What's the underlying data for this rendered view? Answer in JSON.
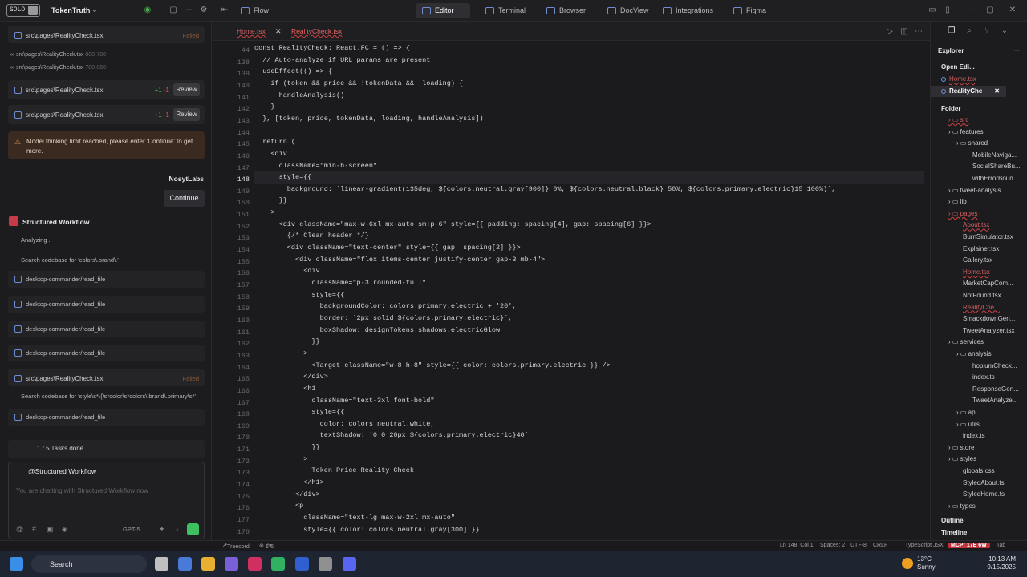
{
  "app": {
    "logo": "SOLO",
    "project": "TokenTruth"
  },
  "top_tabs": [
    {
      "label": "Flow"
    },
    {
      "label": "Editor"
    },
    {
      "label": "Terminal"
    },
    {
      "label": "Browser"
    },
    {
      "label": "DocView"
    },
    {
      "label": "Integrations"
    },
    {
      "label": "Figma"
    }
  ],
  "left": {
    "file1": {
      "name": "src\\pages\\RealityCheck.tsx",
      "status": "Failed"
    },
    "small1": {
      "name": "src\\pages\\RealityCheck.tsx",
      "range": "800-780"
    },
    "small2": {
      "name": "src\\pages\\RealityCheck.tsx",
      "range": "780-860"
    },
    "review1": {
      "name": "src\\pages\\RealityCheck.tsx",
      "plus": "+1",
      "minus": "-1",
      "button": "Review"
    },
    "review2": {
      "name": "src\\pages\\RealityCheck.tsx",
      "plus": "+1",
      "minus": "-1",
      "button": "Review"
    },
    "warning": "Model thinking limit reached, please enter 'Continue' to get more.",
    "user": "NosytLabs",
    "continue": "Continue",
    "workflow_title": "Structured Workflow",
    "analyzing": "Analyzing ..",
    "search1": "Search codebase for 'colors\\.brand\\.'",
    "tools": [
      "desktop-commander/read_file",
      "desktop-commander/read_file",
      "desktop-commander/read_file",
      "desktop-commander/read_file"
    ],
    "file2": {
      "name": "src\\pages\\RealityCheck.tsx",
      "status": "Failed"
    },
    "search2": "Search codebase for 'style\\s*\\{\\s*color\\s*colors\\.brand\\.primary\\s*'",
    "tool5": "desktop-commander/read_file",
    "tasks": "1 / 5 Tasks done",
    "chat_header": "@Structured Workflow",
    "chat_placeholder": "You are chatting with Structured Workflow now",
    "model": "GPT-5"
  },
  "editor": {
    "tabs": [
      "Home.tsx",
      "RealityCheck.tsx"
    ],
    "line_numbers": [
      "44",
      "138",
      "139",
      "140",
      "141",
      "142",
      "143",
      "144",
      "145",
      "146",
      "147",
      "148",
      "149",
      "150",
      "151",
      "152",
      "153",
      "154",
      "155",
      "156",
      "157",
      "158",
      "159",
      "160",
      "161",
      "162",
      "163",
      "164",
      "165",
      "166",
      "167",
      "168",
      "169",
      "170",
      "171",
      "172",
      "173",
      "174",
      "175",
      "176",
      "177",
      "178"
    ],
    "lines": [
      "const RealityCheck: React.FC = () => {",
      "  // Auto-analyze if URL params are present",
      "  useEffect(() => {",
      "    if (token && price && !tokenData && !loading) {",
      "      handleAnalysis()",
      "    }",
      "  }, [token, price, tokenData, loading, handleAnalysis])",
      "",
      "  return (",
      "    <div",
      "      className=\"min-h-screen\"",
      "      style={{",
      "        background: `linear-gradient(135deg, ${colors.neutral.gray[900]} 0%, ${colors.neutral.black} 50%, ${colors.primary.electric}15 100%)`,",
      "      }}",
      "    >",
      "      <div className=\"max-w-6xl mx-auto sm:p-6\" style={{ padding: spacing[4], gap: spacing[6] }}>",
      "        {/* Clean header */}",
      "        <div className=\"text-center\" style={{ gap: spacing[2] }}>",
      "          <div className=\"flex items-center justify-center gap-3 mb-4\">",
      "            <div",
      "              className=\"p-3 rounded-full\"",
      "              style={{",
      "                backgroundColor: colors.primary.electric + '20',",
      "                border: `2px solid ${colors.primary.electric}`,",
      "                boxShadow: designTokens.shadows.electricGlow",
      "              }}",
      "            >",
      "              <Target className=\"w-8 h-8\" style={{ color: colors.primary.electric }} />",
      "            </div>",
      "            <h1",
      "              className=\"text-3xl font-bold\"",
      "              style={{",
      "                color: colors.neutral.white,",
      "                textShadow: `0 0 20px ${colors.primary.electric}40`",
      "              }}",
      "            >",
      "              Token Price Reality Check",
      "            </h1>",
      "          </div>",
      "          <p",
      "            className=\"text-lg max-w-2xl mx-auto\"",
      "            style={{ color: colors.neutral.gray[300] }}"
    ]
  },
  "explorer": {
    "title": "Explorer",
    "open_editors": "Open Edi...",
    "open_files": [
      {
        "name": "Home.tsx",
        "path": "src...",
        "badge": "4"
      },
      {
        "name": "RealityChe",
        "badge": "9+"
      }
    ],
    "folder": "Folder",
    "tree": [
      {
        "name": "src"
      },
      {
        "name": "features"
      },
      {
        "name": "shared"
      },
      {
        "name": "MobileNaviga..."
      },
      {
        "name": "SocialShareBu..."
      },
      {
        "name": "withErrorBoun..."
      },
      {
        "name": "tweet-analysis"
      },
      {
        "name": "lib"
      },
      {
        "name": "pages"
      },
      {
        "name": "About.tsx"
      },
      {
        "name": "BurnSimulator.tsx"
      },
      {
        "name": "Explainer.tsx"
      },
      {
        "name": "Gallery.tsx"
      },
      {
        "name": "Home.tsx"
      },
      {
        "name": "MarketCapCom..."
      },
      {
        "name": "NotFound.tsx"
      },
      {
        "name": "RealityChe..."
      },
      {
        "name": "SmackdownGen..."
      },
      {
        "name": "TweetAnalyzer.tsx"
      },
      {
        "name": "services"
      },
      {
        "name": "analysis"
      },
      {
        "name": "hopiumCheck..."
      },
      {
        "name": "index.ts"
      },
      {
        "name": "ResponseGen..."
      },
      {
        "name": "TweetAnalyze..."
      },
      {
        "name": "api"
      },
      {
        "name": "utils"
      },
      {
        "name": "index.ts"
      },
      {
        "name": "store"
      },
      {
        "name": "styles"
      },
      {
        "name": "globals.css"
      },
      {
        "name": "StyledAbout.ts"
      },
      {
        "name": "StyledHome.ts"
      },
      {
        "name": "types"
      }
    ],
    "badges": {
      "src": "●",
      "about": "●",
      "home": "4",
      "reality": "9+"
    },
    "outline": "Outline",
    "timeline": "Timeline"
  },
  "status": {
    "branch": "Traecord",
    "problems": "17",
    "warnings": "6",
    "position": "Ln 148, Col 1",
    "spaces": "Spaces: 2",
    "encoding": "UTF-8",
    "eol": "CRLF",
    "lang": "TypeScript JSX",
    "mcp": "MCP: 17E 6W",
    "tab": "Tab"
  },
  "taskbar": {
    "search": "Search",
    "temp": "13°C",
    "weather": "Sunny",
    "time": "10:13 AM",
    "date": "9/15/2025"
  }
}
